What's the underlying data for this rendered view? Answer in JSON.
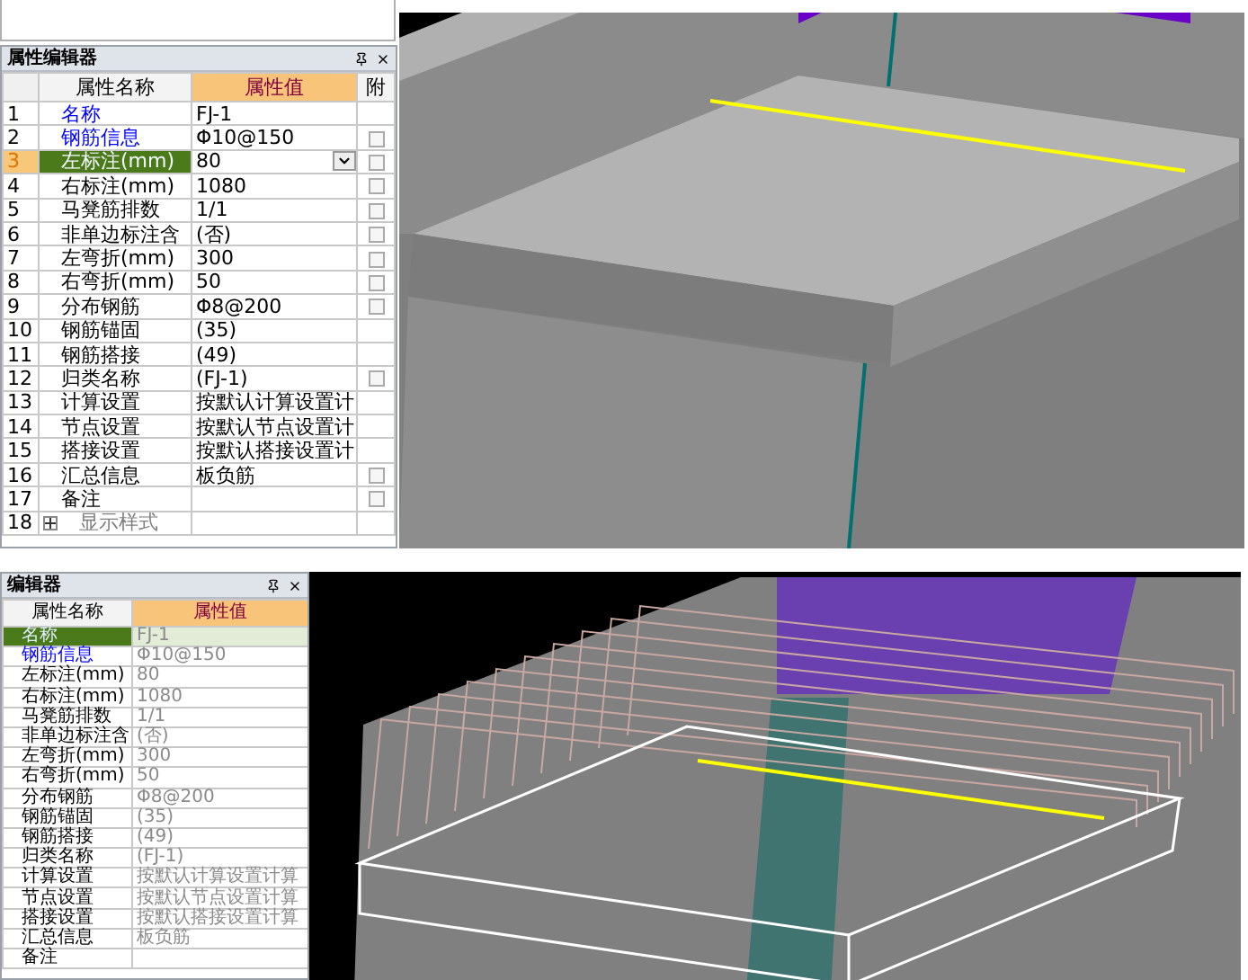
{
  "top_screen": {
    "panel": {
      "title": "属性编辑器",
      "columns": [
        {
          "label": "属性名称"
        },
        {
          "label": "属性值"
        },
        {
          "label": "附"
        }
      ],
      "rows": [
        {
          "number": "1",
          "name": "名称",
          "value": "FJ-1",
          "kind": "key",
          "selected": false
        },
        {
          "number": "2",
          "name": "钢筋信息",
          "value": "Φ10@150",
          "kind": "key",
          "selected": false,
          "checked": false
        },
        {
          "number": "3",
          "name": "左标注(mm)",
          "value": "80",
          "kind": "plain",
          "selected": true,
          "checked": false
        },
        {
          "number": "4",
          "name": "右标注(mm)",
          "value": "1080",
          "kind": "plain",
          "selected": false,
          "checked": false
        },
        {
          "number": "5",
          "name": "马凳筋排数",
          "value": "1/1",
          "kind": "plain",
          "selected": false,
          "checked": false
        },
        {
          "number": "6",
          "name": "非单边标注含",
          "value": "(否)",
          "kind": "plain",
          "selected": false,
          "checked": false
        },
        {
          "number": "7",
          "name": "左弯折(mm)",
          "value": "300",
          "kind": "plain",
          "selected": false,
          "checked": false
        },
        {
          "number": "8",
          "name": "右弯折(mm)",
          "value": "50",
          "kind": "plain",
          "selected": false,
          "checked": false
        },
        {
          "number": "9",
          "name": "分布钢筋",
          "value": "Φ8@200",
          "kind": "plain",
          "selected": false,
          "checked": false
        },
        {
          "number": "10",
          "name": "钢筋锚固",
          "value": "(35)",
          "kind": "plain",
          "selected": false
        },
        {
          "number": "11",
          "name": "钢筋搭接",
          "value": "(49)",
          "kind": "plain",
          "selected": false
        },
        {
          "number": "12",
          "name": "归类名称",
          "value": "(FJ-1)",
          "kind": "plain",
          "selected": false,
          "checked": false
        },
        {
          "number": "13",
          "name": "计算设置",
          "value": "按默认计算设置计",
          "kind": "plain",
          "selected": false
        },
        {
          "number": "14",
          "name": "节点设置",
          "value": "按默认节点设置计",
          "kind": "plain",
          "selected": false
        },
        {
          "number": "15",
          "name": "搭接设置",
          "value": "按默认搭接设置计",
          "kind": "plain",
          "selected": false
        },
        {
          "number": "16",
          "name": "汇总信息",
          "value": "板负筋",
          "kind": "plain",
          "selected": false,
          "checked": false
        },
        {
          "number": "17",
          "name": "备注",
          "kind": "plain",
          "selected": false,
          "checked": false
        },
        {
          "number": "18",
          "name": "显示样式",
          "kind": "group",
          "selected": false,
          "expanded": false
        }
      ]
    }
  },
  "bottom_screen": {
    "panel": {
      "title": "编辑器",
      "columns": [
        {
          "label": "属性名称"
        },
        {
          "label": "属性值"
        }
      ],
      "rows": [
        {
          "name": "名称",
          "value": "FJ-1",
          "kind": "key",
          "selected": true
        },
        {
          "name": "钢筋信息",
          "value": "Φ10@150",
          "kind": "key",
          "selected": false
        },
        {
          "name": "左标注(mm)",
          "value": "80",
          "kind": "plain",
          "selected": false
        },
        {
          "name": "右标注(mm)",
          "value": "1080",
          "kind": "plain",
          "selected": false
        },
        {
          "name": "马凳筋排数",
          "value": "1/1",
          "kind": "plain",
          "selected": false
        },
        {
          "name": "非单边标注含",
          "value": "(否)",
          "kind": "plain",
          "selected": false
        },
        {
          "name": "左弯折(mm)",
          "value": "300",
          "kind": "plain",
          "selected": false
        },
        {
          "name": "右弯折(mm)",
          "value": "50",
          "kind": "plain",
          "selected": false
        },
        {
          "name": "分布钢筋",
          "value": "Φ8@200",
          "kind": "plain",
          "selected": false
        },
        {
          "name": "钢筋锚固",
          "value": "(35)",
          "kind": "plain",
          "selected": false
        },
        {
          "name": "钢筋搭接",
          "value": "(49)",
          "kind": "plain",
          "selected": false
        },
        {
          "name": "归类名称",
          "value": "(FJ-1)",
          "kind": "plain",
          "selected": false
        },
        {
          "name": "计算设置",
          "value": "按默认计算设置计算",
          "kind": "plain",
          "selected": false
        },
        {
          "name": "节点设置",
          "value": "按默认节点设置计算",
          "kind": "plain",
          "selected": false
        },
        {
          "name": "搭接设置",
          "value": "按默认搭接设置计算",
          "kind": "plain",
          "selected": false
        },
        {
          "name": "汇总信息",
          "value": "板负筋",
          "kind": "plain",
          "selected": false
        },
        {
          "name": "备注",
          "kind": "plain",
          "selected": false
        }
      ]
    }
  }
}
